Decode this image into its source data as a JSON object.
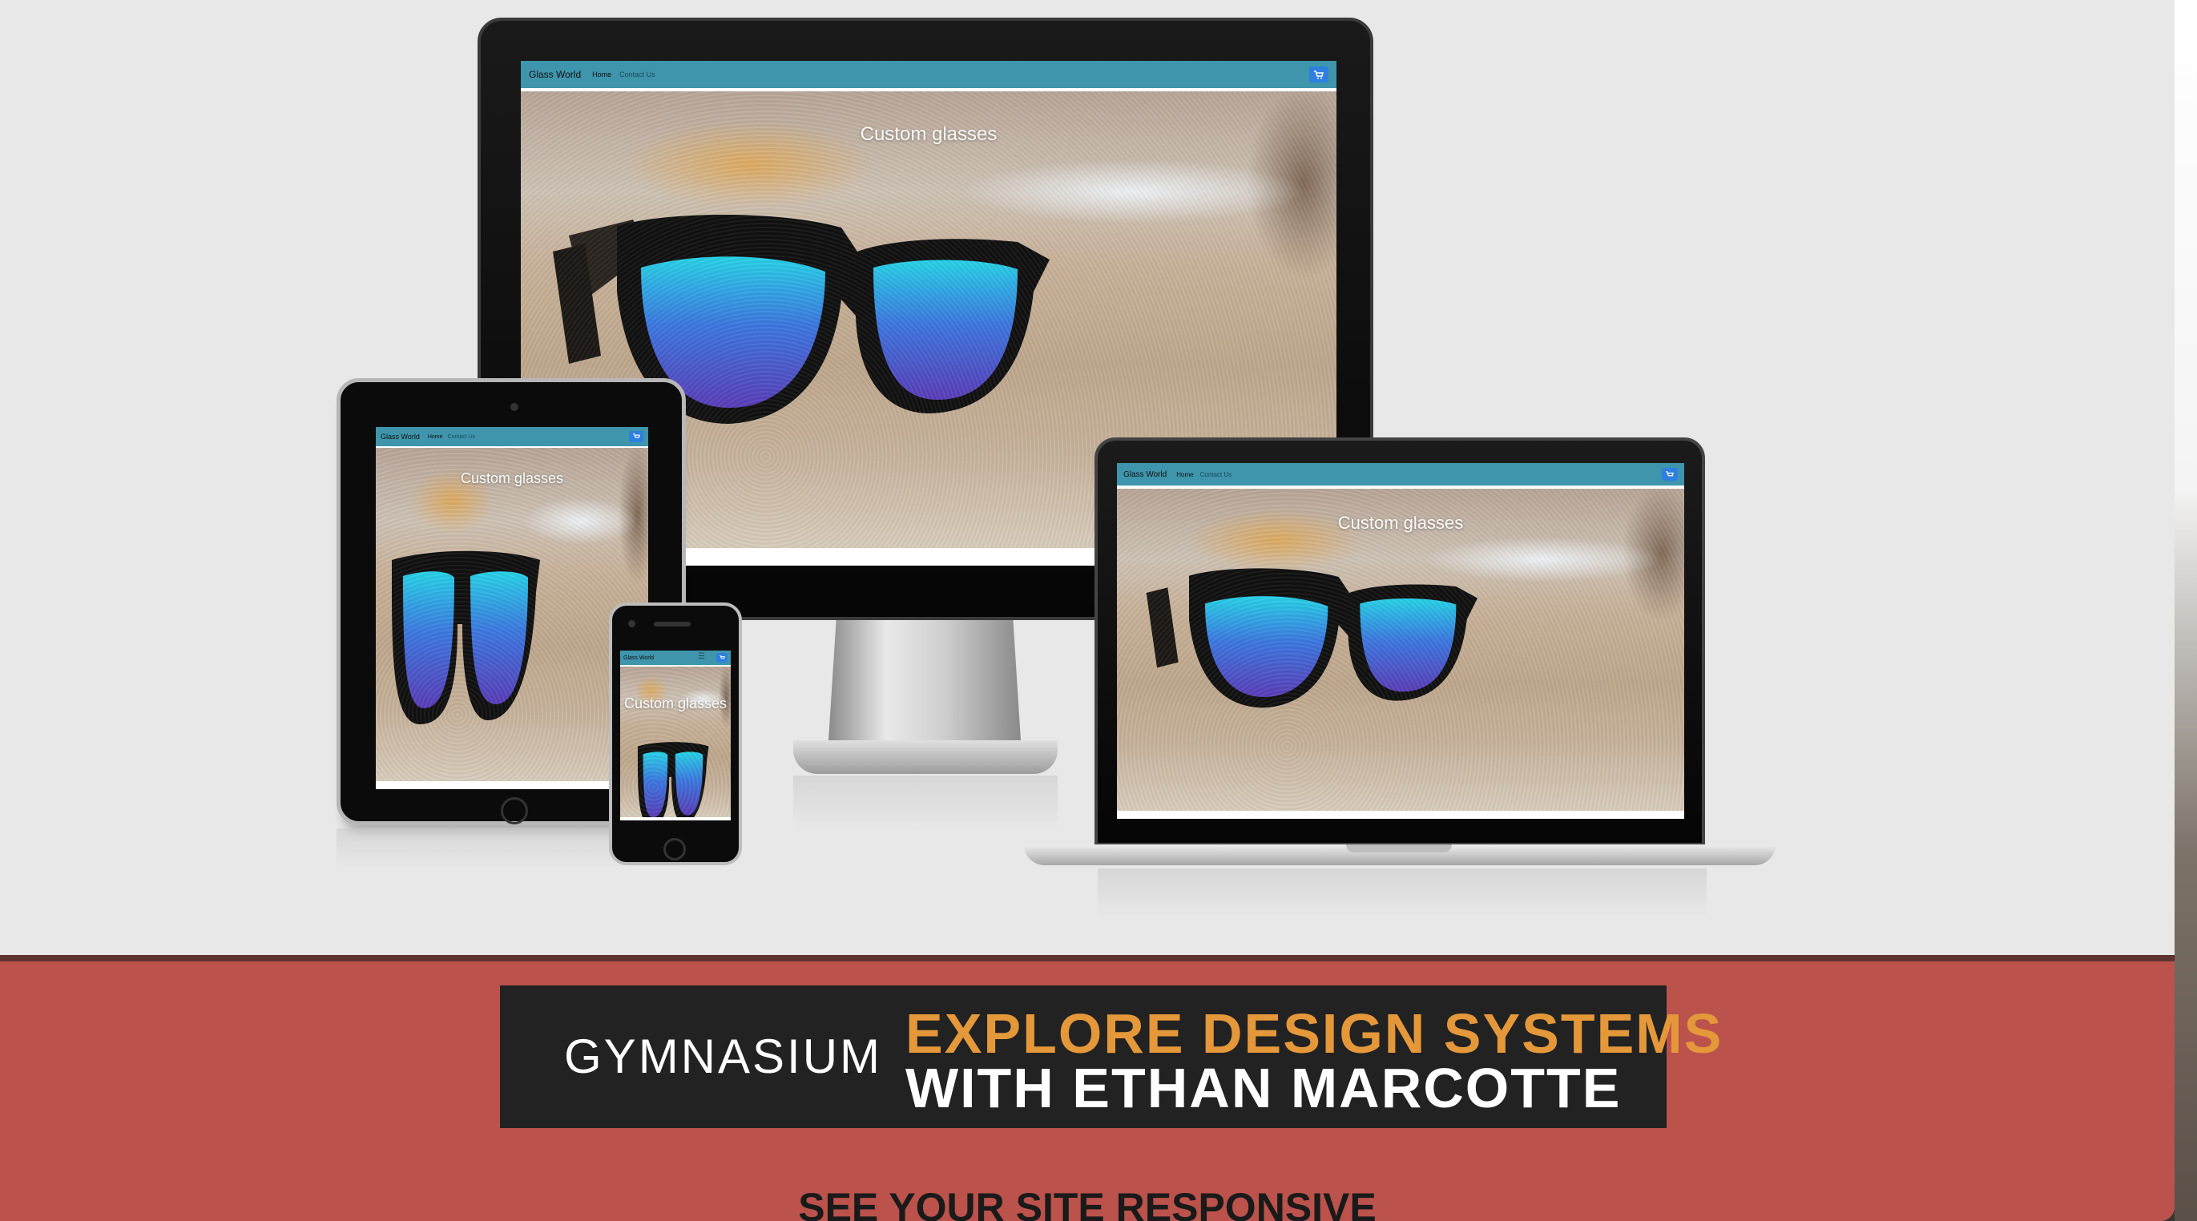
{
  "mockup": {
    "brand": "Glass World",
    "nav_home": "Home",
    "nav_contact": "Contact Us",
    "hero_text": "Custom glasses",
    "cart_icon": "cart-icon",
    "menu_icon": "hamburger-menu-icon"
  },
  "banner": {
    "logo": "GYMNASIUM",
    "line1": "EXPLORE DESIGN SYSTEMS",
    "line2": "WITH ETHAN MARCOTTE"
  },
  "section": {
    "heading": "SEE YOUR SITE RESPONSIVE"
  },
  "colors": {
    "page_bg": "#e8e8e8",
    "navbar": "#3e95ac",
    "cart_button": "#2f7fe0",
    "band": "#bb524b",
    "banner_bg": "#222222",
    "banner_accent": "#e4983a"
  }
}
